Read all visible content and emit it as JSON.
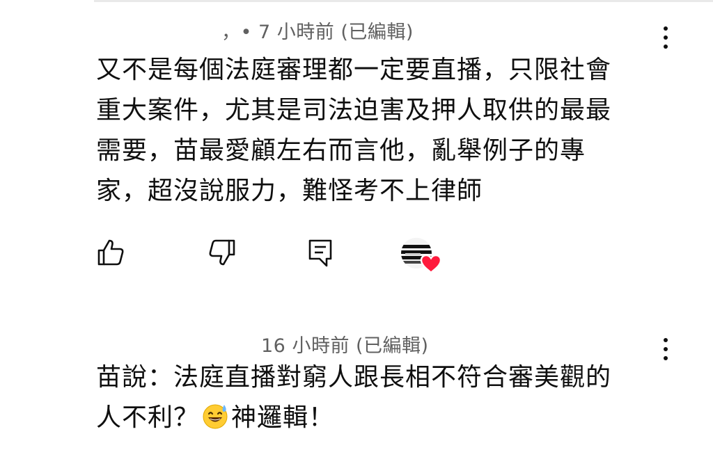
{
  "comments": [
    {
      "meta": "，• 7 小時前 (已編輯)",
      "lines": [
        "又不是每個法庭審理都一定要直播，只限社會",
        "重大案件，尤其是司法迫害及押人取供的最最",
        "需要，苗最愛顧左右而言他，亂舉例子的專",
        "家，超沒說服力，難怪考不上律師"
      ],
      "icons": {
        "like": "thumbs-up-icon",
        "dislike": "thumbs-down-icon",
        "reply": "reply-comment-icon",
        "creator_heart": "creator-heart-icon",
        "more": "more-vert-icon"
      },
      "colors": {
        "heart": "#ff1b3d",
        "meta": "#606060"
      }
    },
    {
      "meta": "16 小時前 (已編輯)",
      "line1": "苗說：法庭直播對窮人跟長相不符合審美觀的",
      "line2_before": "人不利？",
      "emoji": "grinning-sweat-emoji",
      "line2_after": "神邏輯！",
      "icons": {
        "more": "more-vert-icon"
      }
    }
  ]
}
